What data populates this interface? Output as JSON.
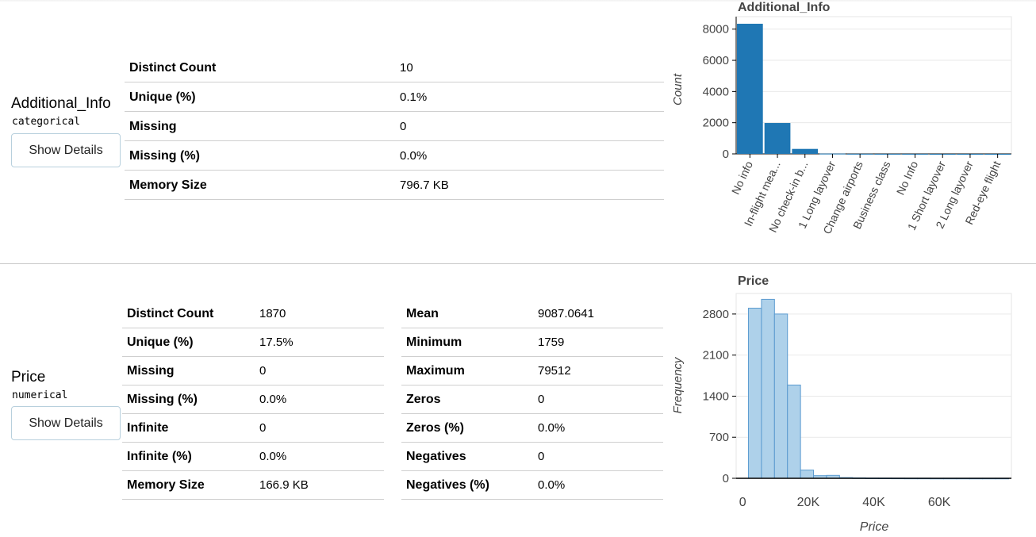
{
  "variables": [
    {
      "name": "Additional_Info",
      "type": "categorical",
      "button": "Show Details",
      "stats": [
        {
          "label": "Distinct Count",
          "value": "10"
        },
        {
          "label": "Unique (%)",
          "value": "0.1%"
        },
        {
          "label": "Missing",
          "value": "0"
        },
        {
          "label": "Missing (%)",
          "value": "0.0%"
        },
        {
          "label": "Memory Size",
          "value": "796.7 KB"
        }
      ]
    },
    {
      "name": "Price",
      "type": "numerical",
      "button": "Show Details",
      "stats_left": [
        {
          "label": "Distinct Count",
          "value": "1870"
        },
        {
          "label": "Unique (%)",
          "value": "17.5%"
        },
        {
          "label": "Missing",
          "value": "0"
        },
        {
          "label": "Missing (%)",
          "value": "0.0%"
        },
        {
          "label": "Infinite",
          "value": "0"
        },
        {
          "label": "Infinite (%)",
          "value": "0.0%"
        },
        {
          "label": "Memory Size",
          "value": "166.9 KB"
        }
      ],
      "stats_right": [
        {
          "label": "Mean",
          "value": "9087.0641"
        },
        {
          "label": "Minimum",
          "value": "1759"
        },
        {
          "label": "Maximum",
          "value": "79512"
        },
        {
          "label": "Zeros",
          "value": "0"
        },
        {
          "label": "Zeros (%)",
          "value": "0.0%"
        },
        {
          "label": "Negatives",
          "value": "0"
        },
        {
          "label": "Negatives (%)",
          "value": "0.0%"
        }
      ]
    }
  ],
  "chart_data": [
    {
      "type": "bar",
      "title": "Additional_Info",
      "xlabel": "",
      "ylabel": "Count",
      "ylim": [
        0,
        8800
      ],
      "yticks": [
        0,
        2000,
        4000,
        6000,
        8000
      ],
      "categories": [
        "No info",
        "In-flight mea...",
        "No check-in b...",
        "1 Long layover",
        "Change airports",
        "Business class",
        "No Info",
        "1 Short layover",
        "2 Long layover",
        "Red-eye flight"
      ],
      "values": [
        8345,
        1982,
        320,
        19,
        7,
        4,
        3,
        1,
        1,
        1
      ],
      "color": "#1f77b4",
      "grid": true
    },
    {
      "type": "bar",
      "title": "Price",
      "xlabel": "Price",
      "ylabel": "Frequency",
      "xlim": [
        -2000,
        82000
      ],
      "ylim": [
        0,
        3150
      ],
      "yticks": [
        0,
        700,
        1400,
        2100,
        2800
      ],
      "xticks": [
        0,
        20000,
        40000,
        60000
      ],
      "xtick_labels": [
        "0",
        "20K",
        "40K",
        "60K"
      ],
      "bin_width": 3970,
      "bin_start": 1759,
      "values": [
        2900,
        3050,
        2800,
        1590,
        140,
        45,
        50,
        12,
        8,
        5,
        4,
        3,
        2,
        2,
        1,
        1,
        1,
        1,
        1,
        1
      ],
      "fill": "#aed1ea",
      "stroke": "#5b9bd0",
      "grid": true
    }
  ]
}
